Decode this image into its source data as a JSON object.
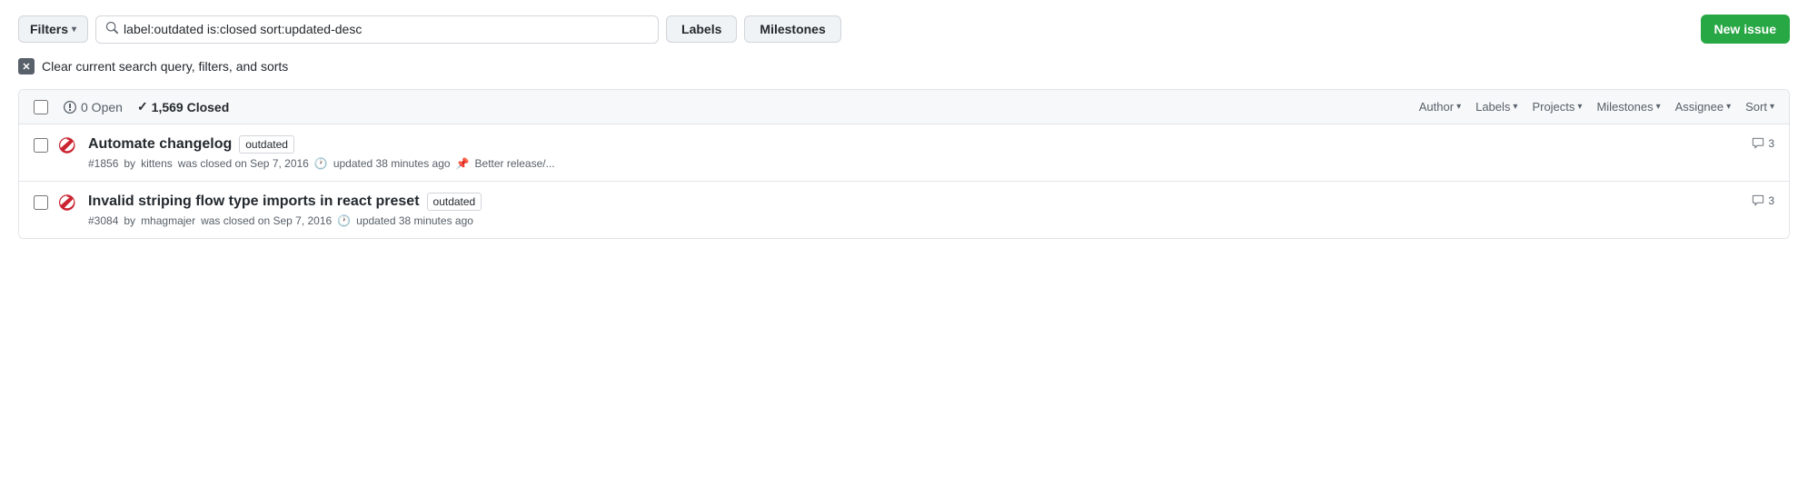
{
  "topbar": {
    "filters_label": "Filters",
    "search_value": "label:outdated is:closed sort:updated-desc",
    "labels_label": "Labels",
    "milestones_label": "Milestones",
    "new_issue_label": "New issue"
  },
  "clear_search": {
    "text": "Clear current search query, filters, and sorts"
  },
  "issues_header": {
    "open_count": "0 Open",
    "closed_count": "1,569 Closed",
    "author_label": "Author",
    "labels_label": "Labels",
    "projects_label": "Projects",
    "milestones_label": "Milestones",
    "assignee_label": "Assignee",
    "sort_label": "Sort"
  },
  "issues": [
    {
      "id": "issue-1",
      "title": "Automate changelog",
      "label": "outdated",
      "meta_number": "#1856",
      "meta_author": "kittens",
      "meta_closed": "was closed on Sep 7, 2016",
      "meta_updated": "updated 38 minutes ago",
      "meta_milestone": "Better release/...",
      "comments": "3"
    },
    {
      "id": "issue-2",
      "title": "Invalid striping flow type imports in react preset",
      "label": "outdated",
      "meta_number": "#3084",
      "meta_author": "mhagmajer",
      "meta_closed": "was closed on Sep 7, 2016",
      "meta_updated": "updated 38 minutes ago",
      "meta_milestone": null,
      "comments": "3"
    }
  ]
}
